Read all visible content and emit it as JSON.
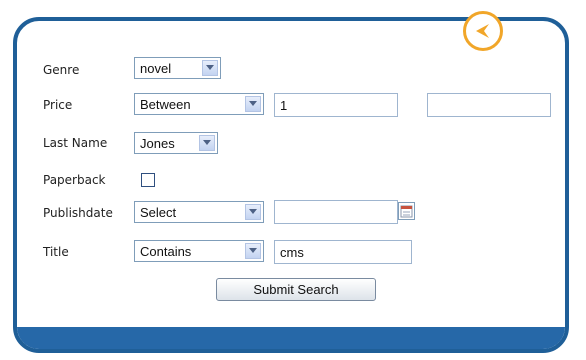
{
  "colors": {
    "frame": "#1f5f98",
    "bottom_bar": "#2668a8",
    "back_accent": "#f1a629"
  },
  "icons": {
    "back": "chevron-left-icon",
    "select_arrow": "chevron-down-icon",
    "calendar": "calendar-icon"
  },
  "form": {
    "genre": {
      "label": "Genre",
      "selected": "novel"
    },
    "price": {
      "label": "Price",
      "operator": "Between",
      "min_value": "1",
      "max_value": ""
    },
    "last_name": {
      "label": "Last Name",
      "selected": "Jones"
    },
    "paperback": {
      "label": "Paperback",
      "checked": false
    },
    "publishdate": {
      "label": "Publishdate",
      "operator": "Select",
      "value": ""
    },
    "title": {
      "label": "Title",
      "operator": "Contains",
      "value": "cms"
    },
    "submit_label": "Submit Search"
  }
}
